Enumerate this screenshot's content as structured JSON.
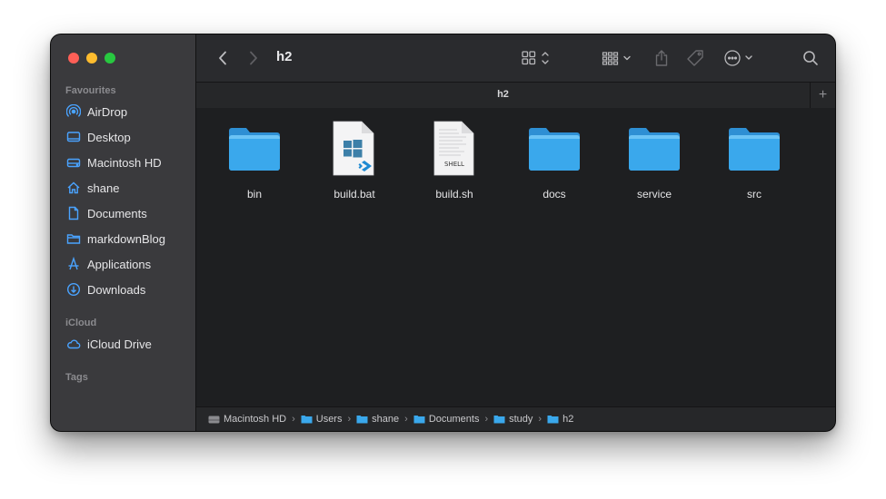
{
  "sidebar": {
    "favourites_heading": "Favourites",
    "favourites": [
      {
        "label": "AirDrop",
        "icon": "airdrop-icon"
      },
      {
        "label": "Desktop",
        "icon": "desktop-icon"
      },
      {
        "label": "Macintosh HD",
        "icon": "drive-icon"
      },
      {
        "label": "shane",
        "icon": "home-icon"
      },
      {
        "label": "Documents",
        "icon": "document-icon"
      },
      {
        "label": "markdownBlog",
        "icon": "folder-icon"
      },
      {
        "label": "Applications",
        "icon": "applications-icon"
      },
      {
        "label": "Downloads",
        "icon": "downloads-icon"
      }
    ],
    "icloud_heading": "iCloud",
    "icloud": [
      {
        "label": "iCloud Drive",
        "icon": "cloud-icon"
      }
    ],
    "tags_heading": "Tags"
  },
  "toolbar": {
    "title": "h2"
  },
  "tab": {
    "label": "h2",
    "add": "+"
  },
  "files": [
    {
      "name": "bin",
      "kind": "folder"
    },
    {
      "name": "build.bat",
      "kind": "bat"
    },
    {
      "name": "build.sh",
      "kind": "shell",
      "badge": "SHELL"
    },
    {
      "name": "docs",
      "kind": "folder"
    },
    {
      "name": "service",
      "kind": "folder"
    },
    {
      "name": "src",
      "kind": "folder"
    }
  ],
  "pathbar": {
    "separator": "›",
    "items": [
      "Macintosh HD",
      "Users",
      "shane",
      "Documents",
      "study",
      "h2"
    ]
  },
  "colors": {
    "folder": "#3aa6e8",
    "sidebar_accent": "#4aa3ff",
    "window_bg": "#1e1f21",
    "sidebar_bg": "#3a3a3d"
  }
}
